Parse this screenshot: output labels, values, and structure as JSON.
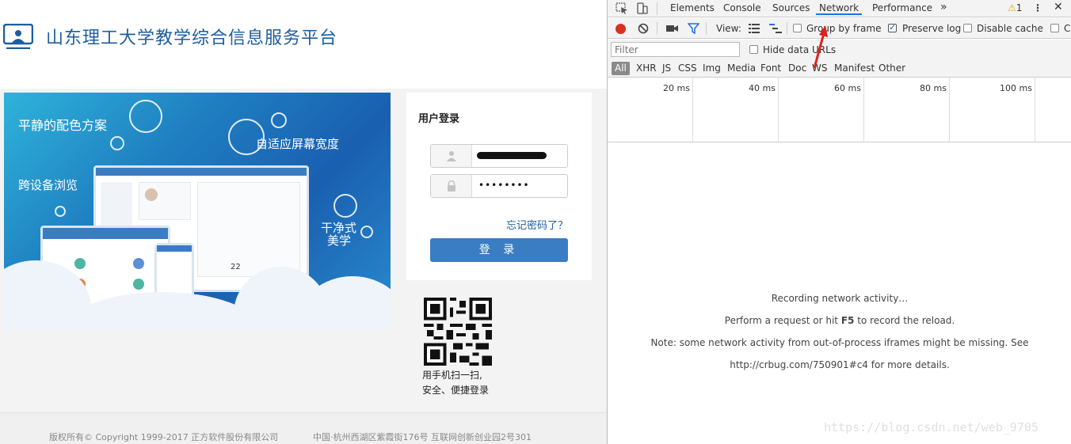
{
  "site": {
    "title": "山东理工大学教学综合信息服务平台",
    "banner": {
      "text_color_scheme": "平静的配色方案",
      "text_adaptive": "自适应屏幕宽度",
      "text_cross_device": "跨设备浏览",
      "text_clean_1": "干净式",
      "text_clean_2": "美学",
      "device_date": "22"
    },
    "login": {
      "title": "用户登录",
      "password_mask": "••••••••",
      "forgot": "忘记密码了？",
      "submit": "登 录"
    },
    "qr": {
      "line1": "用手机扫一扫,",
      "line2": "安全、便捷登录"
    },
    "footer": {
      "copyright": "版权所有© Copyright 1999-2017 正方软件股份有限公司",
      "address": "中国·杭州西湖区紫霞街176号 互联网创新创业园2号301"
    }
  },
  "devtools": {
    "tabs": [
      "Elements",
      "Console",
      "Sources",
      "Network",
      "Performance"
    ],
    "more_tabs": "»",
    "warning_count": "1",
    "toolbar": {
      "view_label": "View:",
      "group_by_frame": "Group by frame",
      "preserve_log": "Preserve log",
      "disable_cache": "Disable cache",
      "truncated": "C"
    },
    "filter": {
      "placeholder": "Filter",
      "hide_data_urls": "Hide data URLs"
    },
    "types": [
      "All",
      "XHR",
      "JS",
      "CSS",
      "Img",
      "Media",
      "Font",
      "Doc",
      "WS",
      "Manifest",
      "Other"
    ],
    "timeline": [
      "20 ms",
      "40 ms",
      "60 ms",
      "80 ms",
      "100 ms"
    ],
    "messages": {
      "recording": "Recording network activity…",
      "perform_prefix": "Perform a request or hit ",
      "perform_key": "F5",
      "perform_suffix": " to record the reload.",
      "note": "Note: some network activity from out-of-process iframes might be missing. See",
      "link": "http://crbug.com/750901#c4 for more details."
    }
  },
  "watermark": "https://blog.csdn.net/web_9705",
  "colors": {
    "brand_blue": "#1e5ea0",
    "button_blue": "#3b7dc3",
    "record_red": "#d93025",
    "arrow_red": "#e0201f"
  }
}
